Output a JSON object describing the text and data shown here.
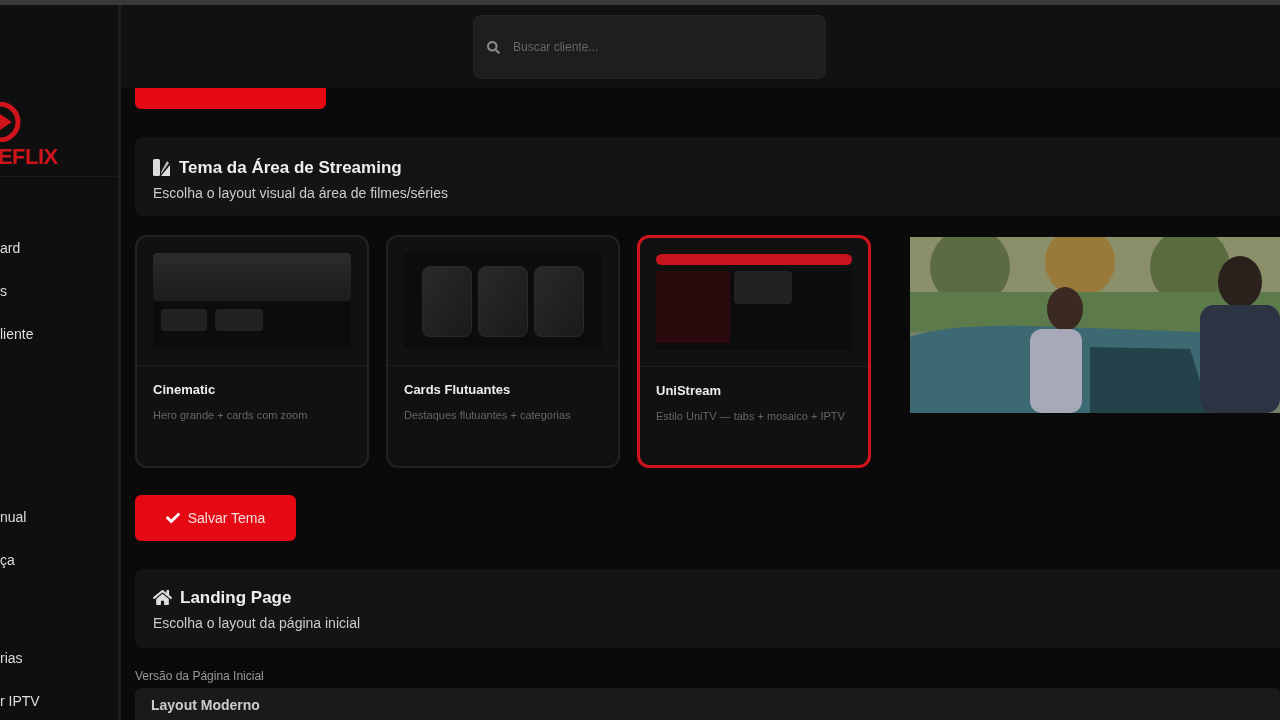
{
  "sidebar": {
    "logo": "EFLIX",
    "items": [
      {
        "label": "ard"
      },
      {
        "label": "s"
      },
      {
        "label": "liente"
      },
      {
        "label": "nual"
      },
      {
        "label": "ça"
      },
      {
        "label": "rias"
      },
      {
        "label": "r IPTV"
      }
    ]
  },
  "search": {
    "placeholder": "Buscar cliente..."
  },
  "theme_section": {
    "title": "Tema da Área de Streaming",
    "subtitle": "Escolha o layout visual da área de filmes/séries"
  },
  "themes": [
    {
      "kind": "hero",
      "name": "Cinematic",
      "description": "Hero grande + cards com zoom",
      "selected": false
    },
    {
      "kind": "cards",
      "name": "Cards Flutuantes",
      "description": "Destaques flutuantes + categorias",
      "selected": false
    },
    {
      "kind": "tabs",
      "name": "UniStream",
      "description": "Estilo UniTV — tabs + mosaico + IPTV",
      "selected": true
    }
  ],
  "save_theme_button": "Salvar Tema",
  "landing_section": {
    "title": "Landing Page",
    "subtitle": "Escolha o layout da página inicial"
  },
  "version_field": {
    "label": "Versão da Página Inicial",
    "value": "Layout Moderno"
  }
}
